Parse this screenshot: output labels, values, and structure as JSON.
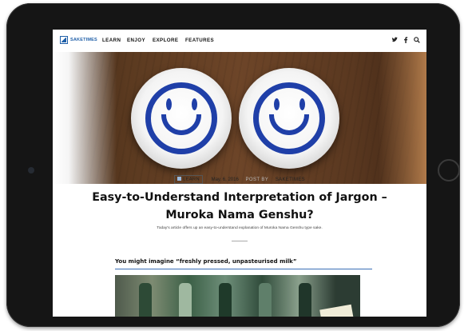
{
  "site": {
    "logo_text": "SAKETIMES",
    "brand_color": "#1f5fa8"
  },
  "nav": {
    "items": [
      "LEARN",
      "ENJOY",
      "EXPLORE",
      "FEATURES"
    ],
    "icons": [
      "twitter-icon",
      "facebook-icon",
      "search-icon"
    ],
    "icon_glyphs": [
      "❧",
      "f",
      "⌕"
    ]
  },
  "article": {
    "category": "LEARN",
    "date": "May. 6, 2016",
    "post_by_label": "POST BY",
    "author": "SAKETIMES",
    "title": "Easy-to-Understand Interpretation of Jargon – Muroka Nama Genshu?",
    "subtitle": "Today's article offers up an easy-to-understand explanation of Muroka Nama Genshu type sake.",
    "section_heading": "You might imagine “freshly pressed, unpasteurised milk”"
  },
  "colors": {
    "accent_blue": "#3a6fb6",
    "smile_blue": "#1f3fa8"
  }
}
